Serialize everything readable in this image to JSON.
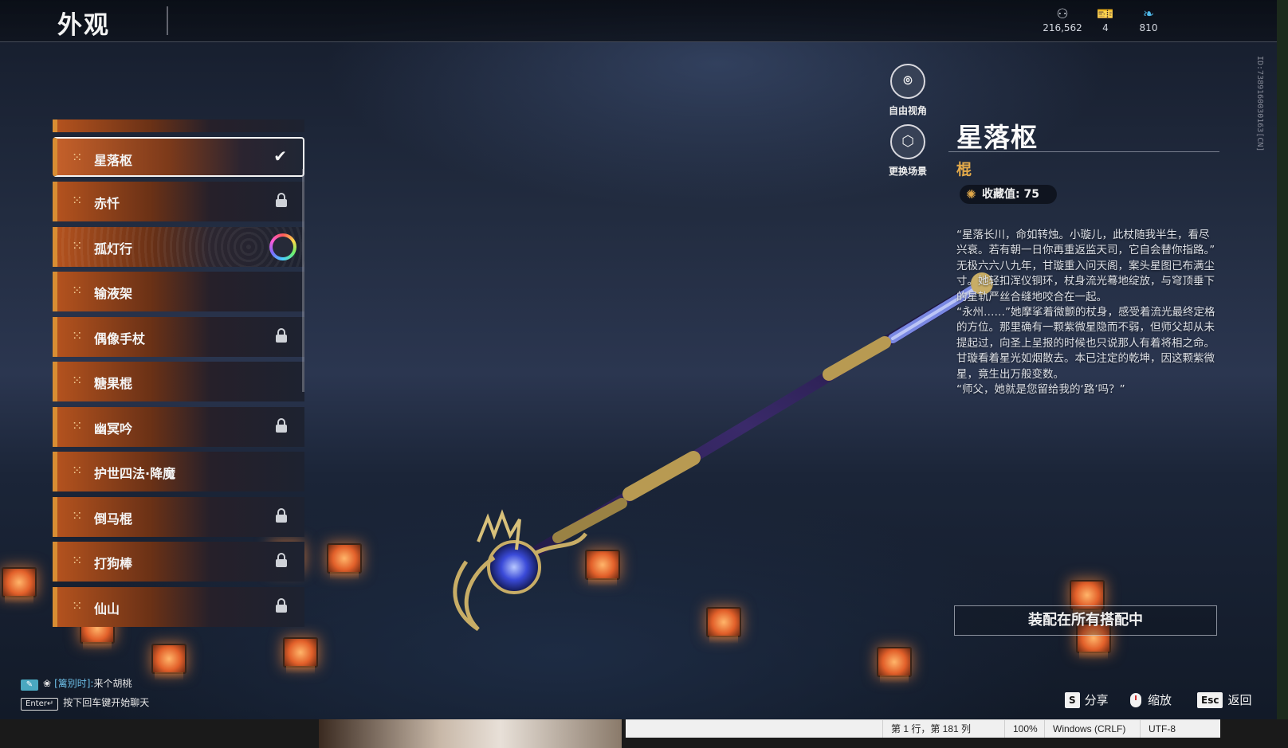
{
  "header": {
    "title": "外观",
    "currencies": [
      {
        "icon": "coin-icon",
        "value": "216,562"
      },
      {
        "icon": "ticket-icon",
        "value": "4"
      },
      {
        "icon": "feather-icon",
        "value": "810"
      }
    ]
  },
  "list": {
    "items": [
      {
        "label": "星落枢",
        "state": "selected"
      },
      {
        "label": "赤忏",
        "state": "locked"
      },
      {
        "label": "孤灯行",
        "state": "rainbow"
      },
      {
        "label": "输液架",
        "state": "none"
      },
      {
        "label": "偶像手杖",
        "state": "locked"
      },
      {
        "label": "糖果棍",
        "state": "none"
      },
      {
        "label": "幽冥吟",
        "state": "locked"
      },
      {
        "label": "护世四法·降魔",
        "state": "none"
      },
      {
        "label": "倒马棍",
        "state": "locked"
      },
      {
        "label": "打狗棒",
        "state": "locked"
      },
      {
        "label": "仙山",
        "state": "locked"
      }
    ]
  },
  "camera": {
    "free_view": "自由视角",
    "change_scene": "更换场景"
  },
  "detail": {
    "name": "星落枢",
    "type": "棍",
    "collect_label": "收藏值: 75",
    "lore": [
      "“星落长川，命如转烛。小璇儿，此杖随我半生，看尽兴衰。若有朝一日你再重返监天司，它自会替你指路。”",
      "无极六六八九年，甘璇重入问天阁，案头星图已布满尘寸。她轻扣浑仪铜环，杖身流光蓦地绽放，与穹顶垂下的星轨严丝合缝地咬合在一起。",
      "“永州……”她摩挲着微颤的杖身，感受着流光最终定格的方位。那里确有一颗紫微星隐而不弱，但师父却从未提起过，向圣上呈报的时候也只说那人有着将相之命。",
      "甘璇看着星光如烟散去。本已注定的乾坤，因这颗紫微星，竟生出万般变数。",
      "“师父，她就是您留给我的‘路’吗？”"
    ],
    "equip_button": "装配在所有搭配中"
  },
  "side_id": "ID:7389160030163[CN]",
  "chat": {
    "tag": "✎",
    "channel": "[篱别时]:",
    "message": "来个胡桃",
    "enter_key": "Enter↵",
    "hint": "按下回车键开始聊天"
  },
  "hotkeys": {
    "share_key": "S",
    "share": "分享",
    "zoom": "缩放",
    "back_key": "Esc",
    "back": "返回"
  },
  "statusbar": {
    "position": "第 1 行，第 181 列",
    "zoom": "100%",
    "eol": "Windows (CRLF)",
    "encoding": "UTF-8"
  }
}
